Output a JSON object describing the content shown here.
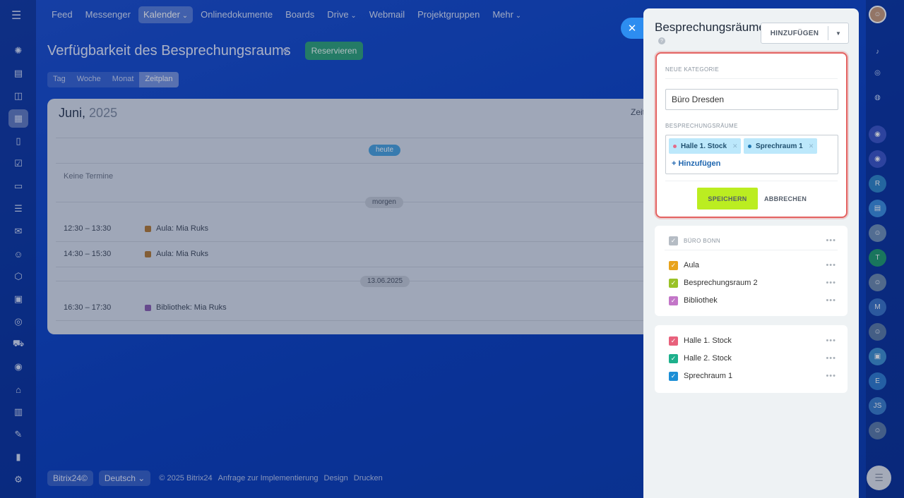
{
  "topnav": {
    "items": [
      "Feed",
      "Messenger",
      "Kalender",
      "Onlinedokumente",
      "Boards",
      "Drive",
      "Webmail",
      "Projektgruppen",
      "Mehr"
    ],
    "active_index": 2
  },
  "page": {
    "title": "Verfügbarkeit des Besprechungsraums",
    "reserve_label": "Reservieren",
    "view_tabs": [
      "Tag",
      "Woche",
      "Monat",
      "Zeitplan"
    ],
    "active_view": 3
  },
  "calendar": {
    "month": "Juni,",
    "year": "2025",
    "right_label": "Zeit",
    "today_label": "heute",
    "no_events": "Keine Termine",
    "tomorrow_label": "morgen",
    "date_label": "13.06.2025",
    "events": [
      {
        "time": "12:30 – 13:30",
        "label": "Aula: Mia Ruks",
        "color": "#b27a38"
      },
      {
        "time": "14:30 – 15:30",
        "label": "Aula: Mia Ruks",
        "color": "#b27a38"
      },
      {
        "time": "16:30 – 17:30",
        "label": "Bibliothek: Mia Ruks",
        "color": "#8a5fb0"
      }
    ]
  },
  "footer": {
    "brand": "Bitrix24©",
    "language": "Deutsch",
    "copyright": "© 2025 Bitrix24",
    "links": [
      "Anfrage zur Implementierung",
      "Design",
      "Drucken"
    ]
  },
  "panel": {
    "title": "Besprechungsräume",
    "add_label": "HINZUFÜGEN",
    "form": {
      "category_label": "NEUE KATEGORIE",
      "name_value": "Büro Dresden",
      "rooms_label": "BESPRECHUNGSRÄUME",
      "tags": [
        {
          "label": "Halle 1. Stock",
          "dot": "#e46c8a"
        },
        {
          "label": "Sprechraum 1",
          "dot": "#1f78b4"
        }
      ],
      "add_link": "+ Hinzufügen",
      "save_label": "SPEICHERN",
      "cancel_label": "ABBRECHEN"
    },
    "group1": {
      "category": "BÜRO BONN",
      "category_color": "#b5bcc4",
      "rooms": [
        {
          "label": "Aula",
          "color": "#e8a31c"
        },
        {
          "label": "Besprechungsraum 2",
          "color": "#9ac227"
        },
        {
          "label": "Bibliothek",
          "color": "#c376c8"
        }
      ]
    },
    "group2": {
      "rooms": [
        {
          "label": "Halle 1. Stock",
          "color": "#e8617c"
        },
        {
          "label": "Halle 2. Stock",
          "color": "#1eb08c"
        },
        {
          "label": "Sprechraum 1",
          "color": "#1d8fd6"
        }
      ]
    }
  },
  "rightbar": {
    "avatars": [
      {
        "initials": "R",
        "color": "#2f86c9"
      },
      {
        "initials": "T",
        "color": "#1f9a6e"
      },
      {
        "initials": "M",
        "color": "#3a73c8"
      },
      {
        "initials": "E",
        "color": "#2f7cd0"
      },
      {
        "initials": "JS",
        "color": "#3a7dcc"
      }
    ]
  }
}
